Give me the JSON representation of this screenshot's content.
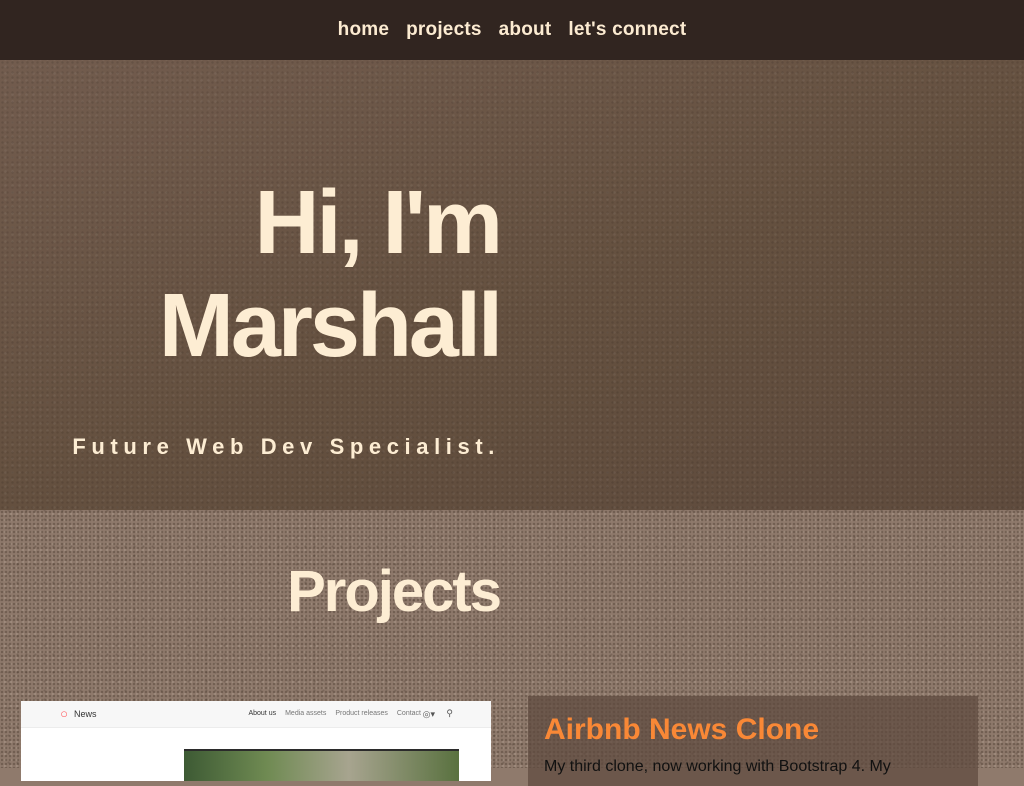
{
  "nav": {
    "items": [
      {
        "label": "home"
      },
      {
        "label": "projects"
      },
      {
        "label": "about"
      },
      {
        "label": "let's connect"
      }
    ]
  },
  "hero": {
    "title_line1": "Hi, I'm",
    "title_line2": "Marshall",
    "subtitle": "Future Web Dev Specialist."
  },
  "projects": {
    "heading": "Projects",
    "items": [
      {
        "title": "Airbnb News Clone",
        "description": "My third clone, now working with Bootstrap 4. My",
        "screenshot": {
          "brand": "News",
          "links": [
            "About us",
            "Media assets",
            "Product releases",
            "Contact"
          ],
          "icons": [
            "airbnb-logo-icon",
            "globe-icon",
            "search-icon"
          ]
        }
      }
    ]
  },
  "colors": {
    "nav_bg": "#312520",
    "hero_bg": "#6a5446",
    "cream_text": "#fdedd3",
    "card_title": "#f98836",
    "section_bg": "#8e796b"
  }
}
